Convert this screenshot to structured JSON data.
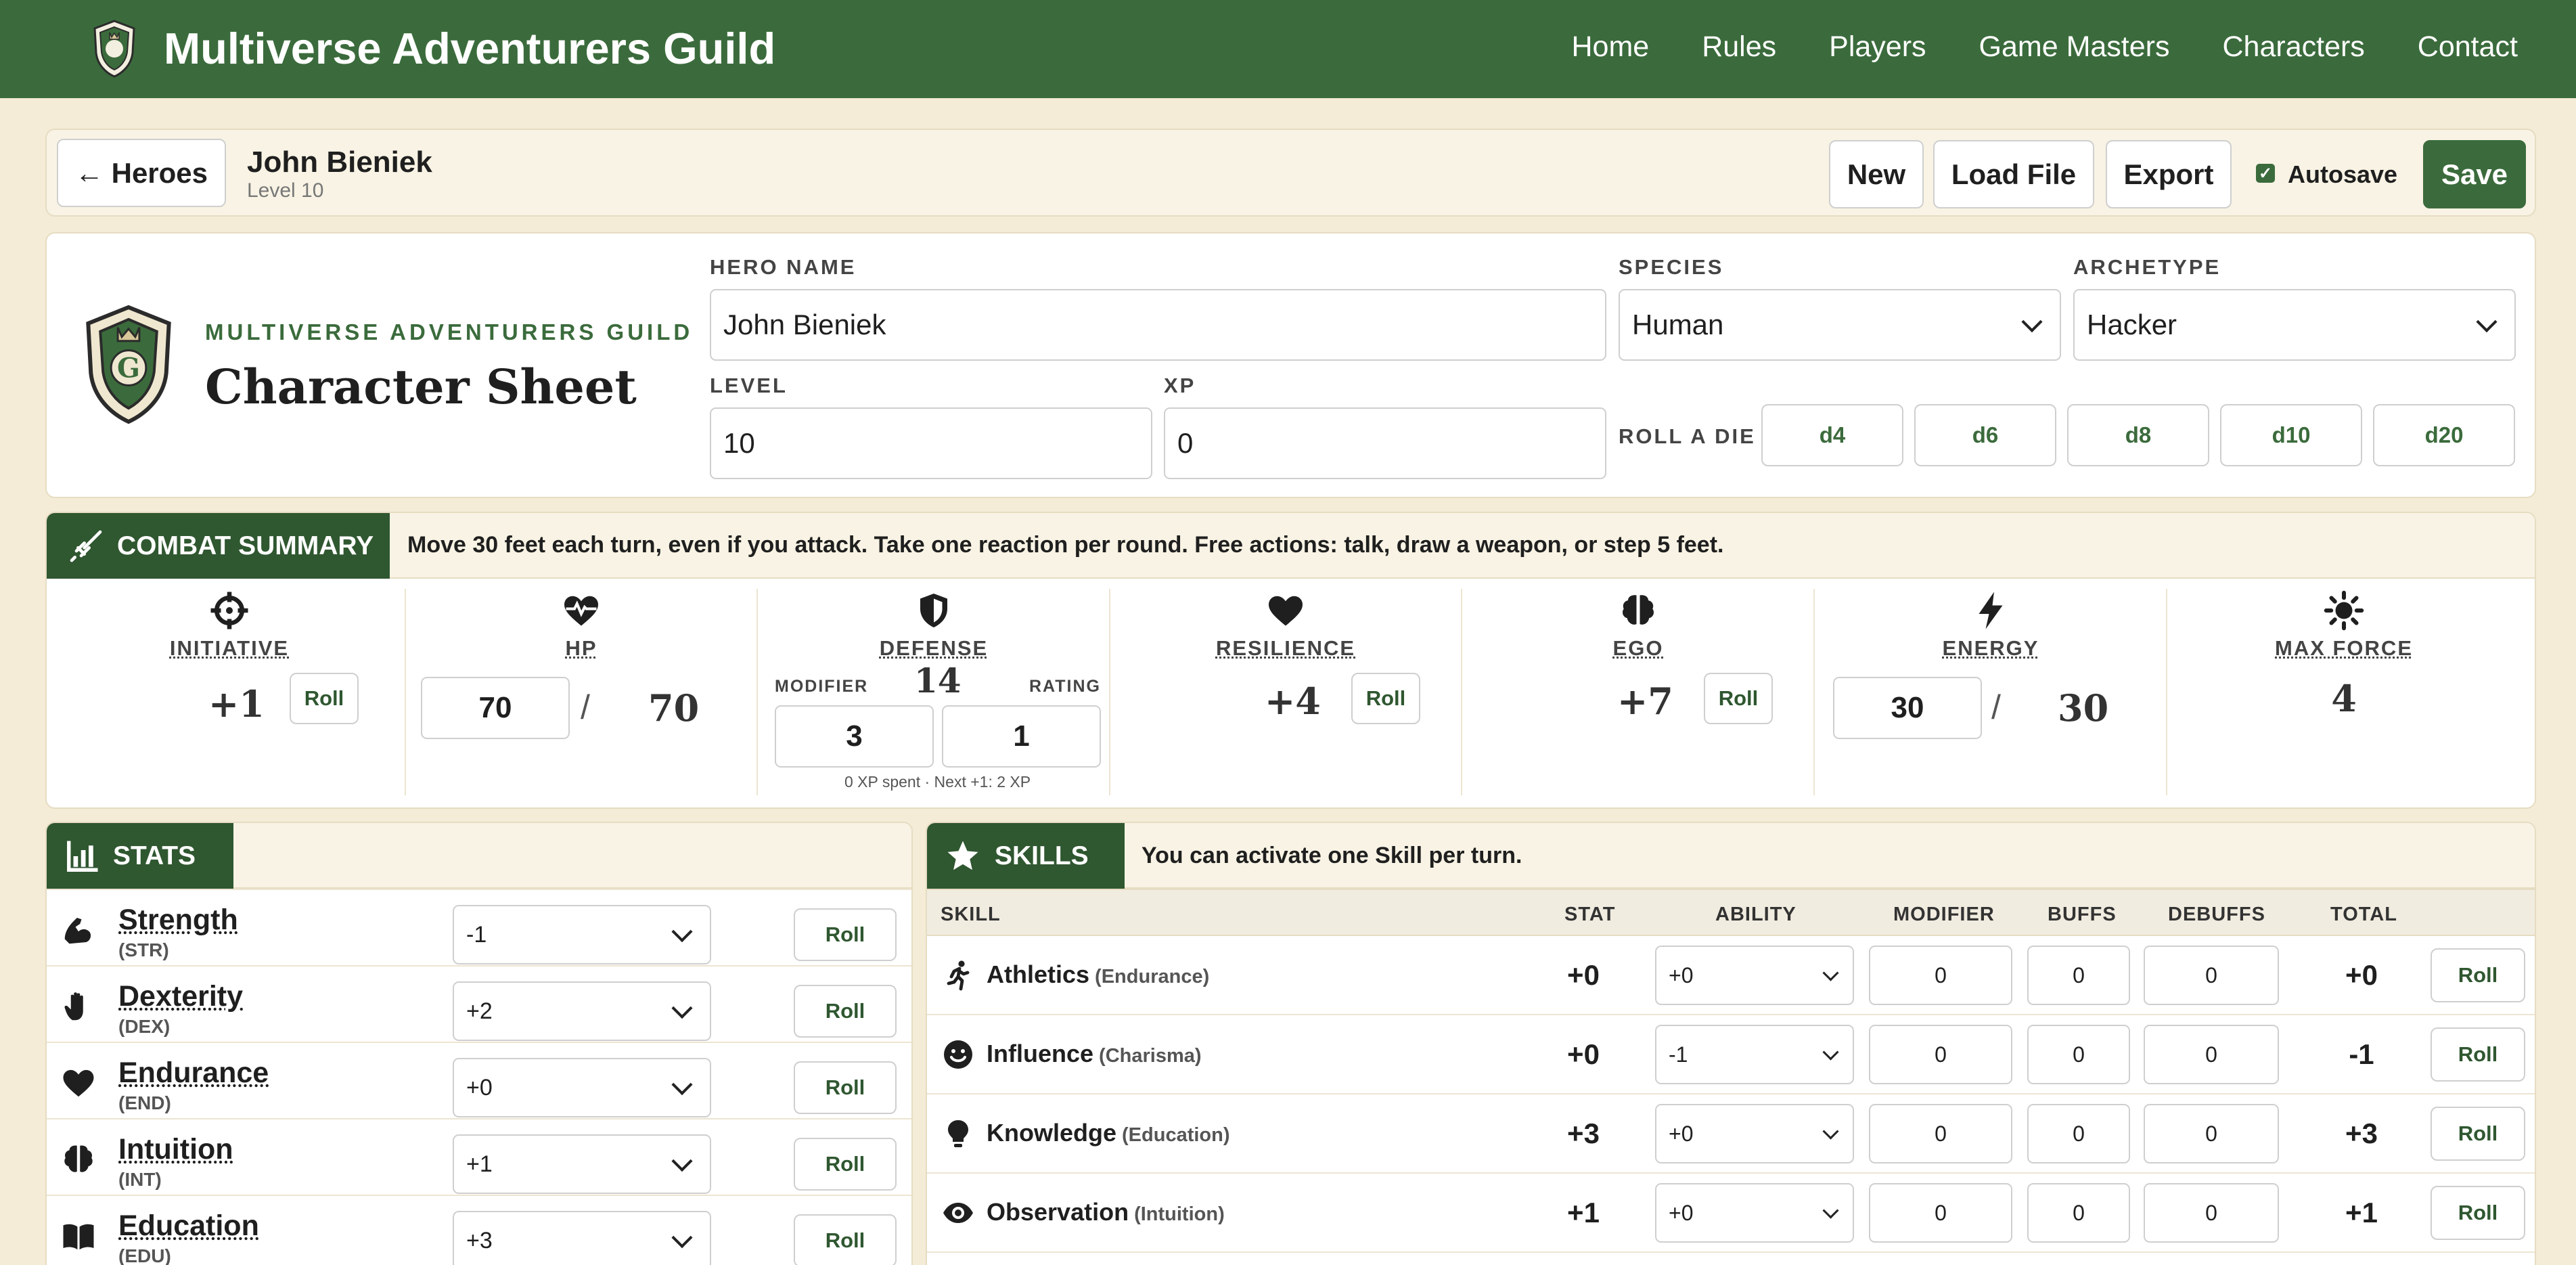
{
  "nav": {
    "site_title": "Multiverse Adventurers Guild",
    "links": [
      "Home",
      "Rules",
      "Players",
      "Game Masters",
      "Characters",
      "Contact"
    ]
  },
  "header": {
    "back_label": "← Heroes",
    "hero_name": "John Bieniek",
    "hero_level": "Level 10",
    "new_label": "New",
    "load_label": "Load File",
    "export_label": "Export",
    "autosave_label": "Autosave",
    "autosave_checked": true,
    "save_label": "Save"
  },
  "sheet": {
    "guild_label": "MULTIVERSE ADVENTURERS GUILD",
    "title": "Character Sheet",
    "hero_name_label": "HERO NAME",
    "hero_name_value": "John Bieniek",
    "species_label": "SPECIES",
    "species_value": "Human",
    "archetype_label": "ARCHETYPE",
    "archetype_value": "Hacker",
    "level_label": "LEVEL",
    "level_value": "10",
    "xp_label": "XP",
    "xp_value": "0",
    "roll_die_label": "ROLL A DIE",
    "dice": [
      "d4",
      "d6",
      "d8",
      "d10",
      "d20"
    ]
  },
  "combat": {
    "tab_label": "COMBAT SUMMARY",
    "note": "Move 30 feet each turn, even if you attack. Take one reaction per round. Free actions: talk, draw a weapon, or step 5 feet.",
    "roll_label": "Roll",
    "initiative": {
      "label": "INITIATIVE",
      "value": "+1",
      "icon": "crosshair-icon"
    },
    "hp": {
      "label": "HP",
      "current": "70",
      "sep": "/",
      "max": "70",
      "icon": "heart-pulse-icon"
    },
    "defense": {
      "label": "DEFENSE",
      "value": "14",
      "modifier_label": "MODIFIER",
      "rating_label": "RATING",
      "modifier": "3",
      "rating": "1",
      "note": "0 XP spent · Next +1: 2 XP",
      "icon": "shield-icon"
    },
    "resilience": {
      "label": "RESILIENCE",
      "value": "+4",
      "icon": "heart-icon"
    },
    "ego": {
      "label": "EGO",
      "value": "+7",
      "icon": "brain-icon"
    },
    "energy": {
      "label": "ENERGY",
      "current": "30",
      "sep": "/",
      "max": "30",
      "icon": "lightning-icon"
    },
    "max_force": {
      "label": "MAX FORCE",
      "value": "4",
      "icon": "sun-icon"
    }
  },
  "stats": {
    "tab_label": "STATS",
    "roll_label": "Roll",
    "items": [
      {
        "name": "Strength",
        "abbr": "(STR)",
        "value": "-1",
        "icon": "flexed-arm-icon"
      },
      {
        "name": "Dexterity",
        "abbr": "(DEX)",
        "value": "+2",
        "icon": "hand-icon"
      },
      {
        "name": "Endurance",
        "abbr": "(END)",
        "value": "+0",
        "icon": "heart-icon"
      },
      {
        "name": "Intuition",
        "abbr": "(INT)",
        "value": "+1",
        "icon": "brain-icon"
      },
      {
        "name": "Education",
        "abbr": "(EDU)",
        "value": "+3",
        "icon": "book-icon"
      }
    ]
  },
  "skills": {
    "tab_label": "SKILLS",
    "note": "You can activate one Skill per turn.",
    "roll_label": "Roll",
    "columns": [
      "SKILL",
      "STAT",
      "ABILITY",
      "MODIFIER",
      "BUFFS",
      "DEBUFFS",
      "TOTAL"
    ],
    "rows": [
      {
        "name": "Athletics",
        "stat_name": "(Endurance)",
        "stat": "+0",
        "ability": "+0",
        "modifier": "0",
        "buffs": "0",
        "debuffs": "0",
        "total": "+0",
        "icon": "running-icon"
      },
      {
        "name": "Influence",
        "stat_name": "(Charisma)",
        "stat": "+0",
        "ability": "-1",
        "modifier": "0",
        "buffs": "0",
        "debuffs": "0",
        "total": "-1",
        "icon": "smile-icon"
      },
      {
        "name": "Knowledge",
        "stat_name": "(Education)",
        "stat": "+3",
        "ability": "+0",
        "modifier": "0",
        "buffs": "0",
        "debuffs": "0",
        "total": "+3",
        "icon": "lightbulb-icon"
      },
      {
        "name": "Observation",
        "stat_name": "(Intuition)",
        "stat": "+1",
        "ability": "+0",
        "modifier": "0",
        "buffs": "0",
        "debuffs": "0",
        "total": "+1",
        "icon": "eye-icon"
      }
    ]
  },
  "colors": {
    "primary": "#3b6b3c",
    "tab": "#2f5730",
    "background": "#f4ecd6"
  }
}
